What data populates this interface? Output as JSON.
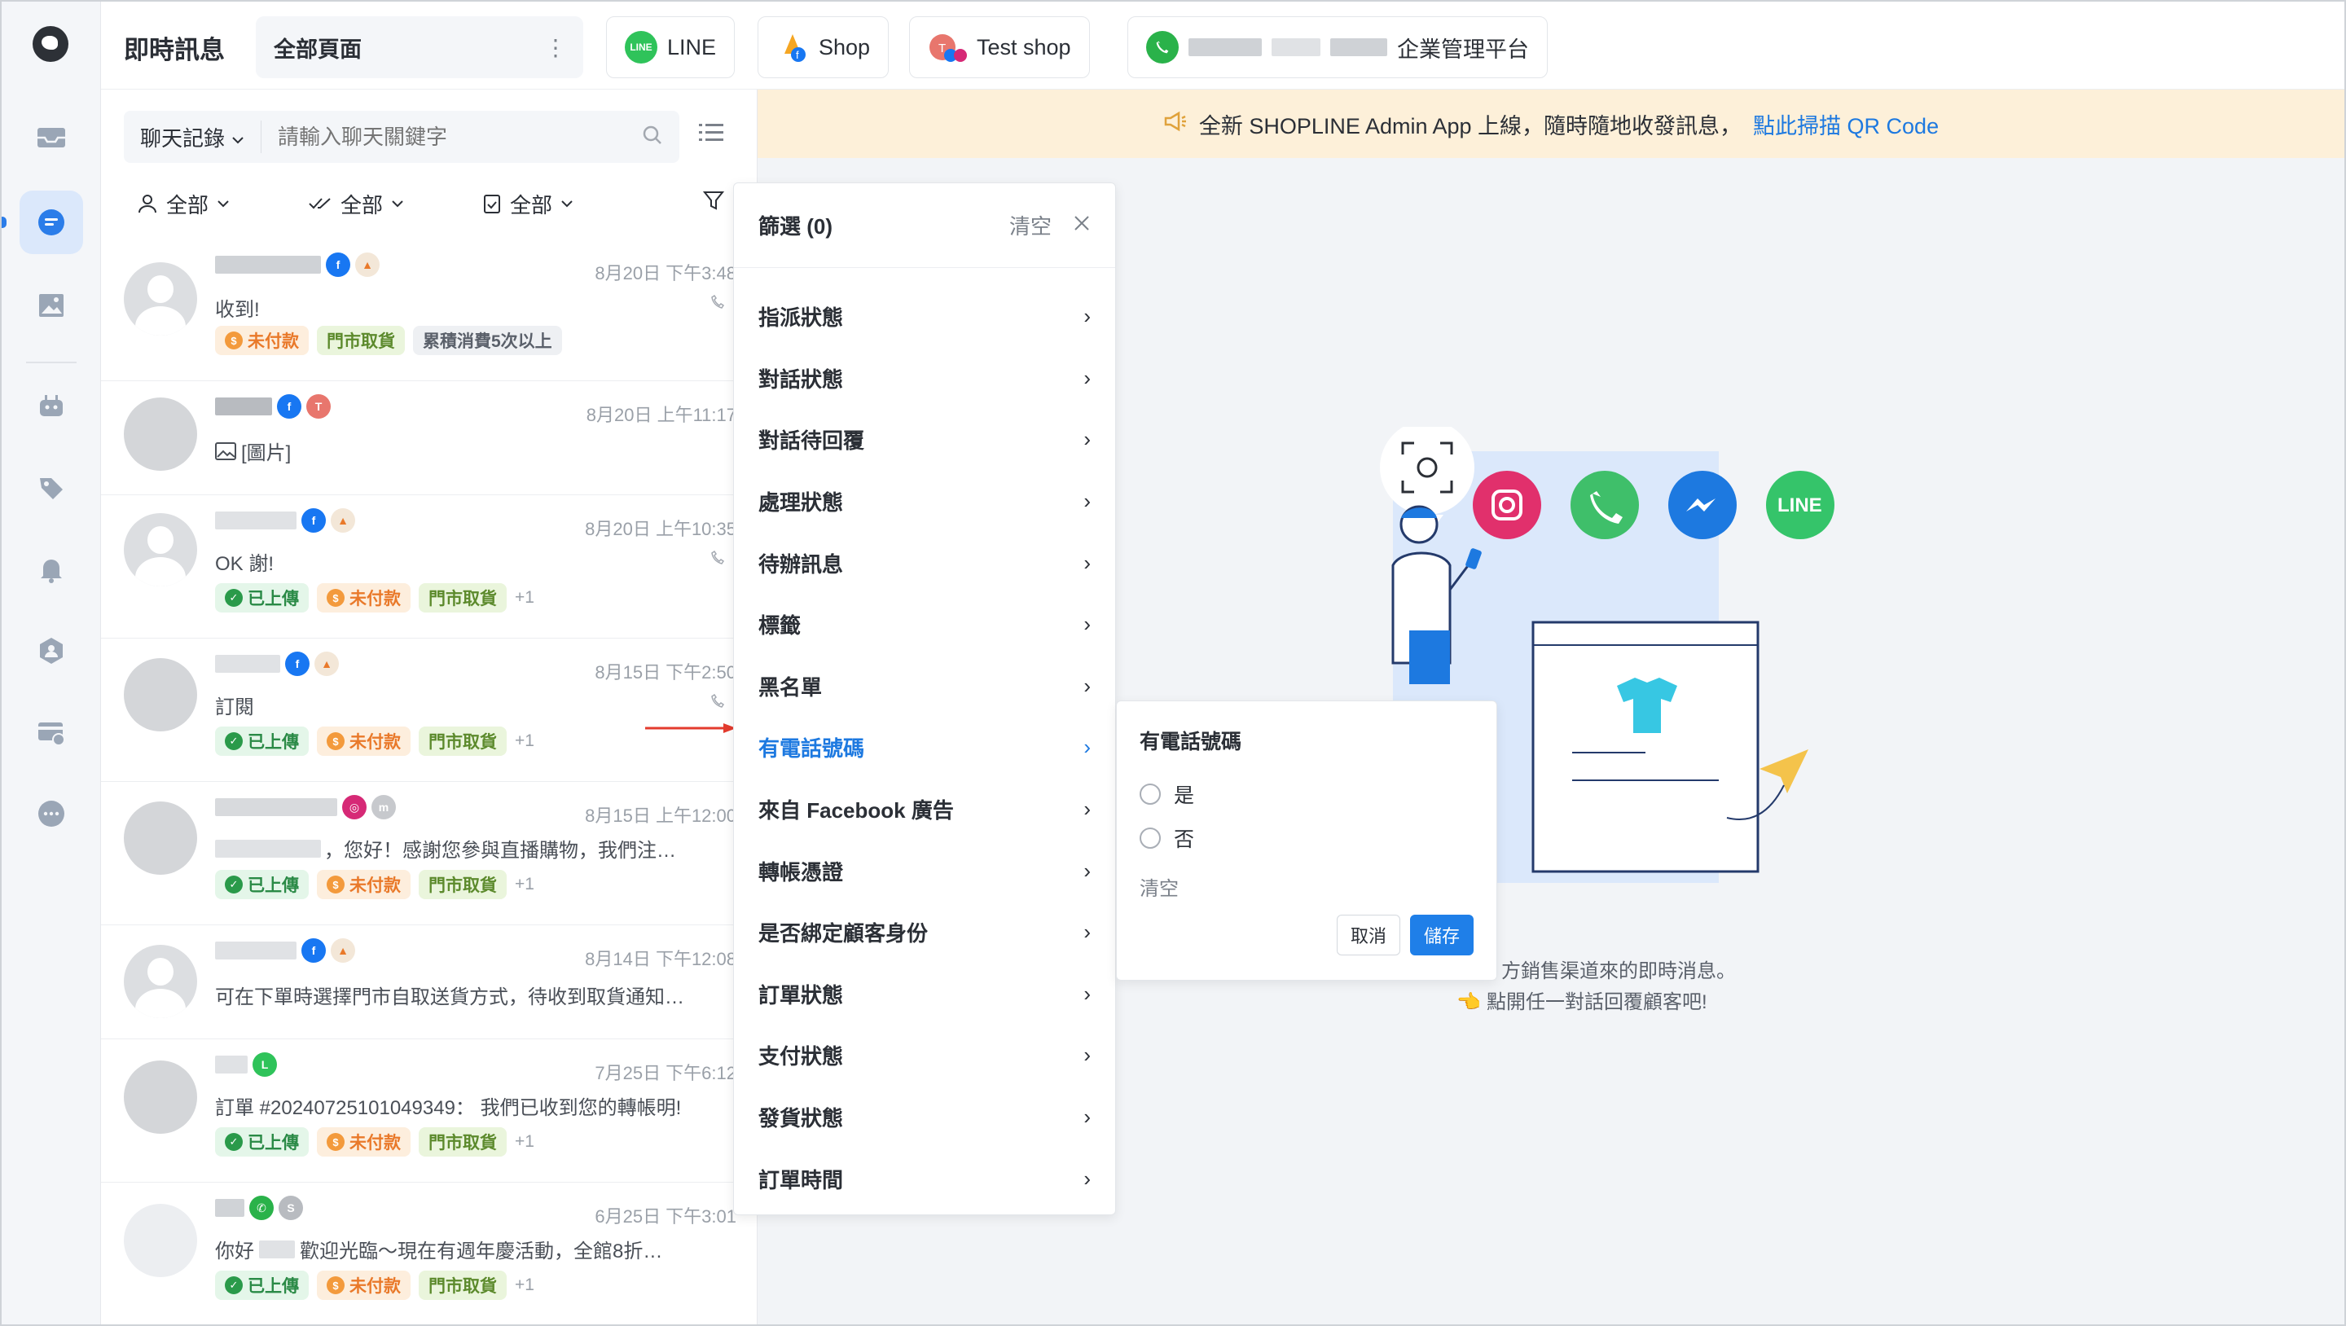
{
  "header": {
    "page_title": "即時訊息",
    "page_select": "全部頁面",
    "channels": [
      {
        "label": "LINE"
      },
      {
        "label": "Shop"
      },
      {
        "label": "Test shop"
      },
      {
        "label": "企業管理平台"
      }
    ]
  },
  "banner": {
    "text": "全新 SHOPLINE Admin App 上線，隨時隨地收發訊息，",
    "link": "點此掃描 QR Code"
  },
  "search": {
    "type": "聊天記錄",
    "placeholder": "請輸入聊天關鍵字"
  },
  "filters": {
    "assignee": "全部",
    "read": "全部",
    "task": "全部"
  },
  "conversations": [
    {
      "time": "8月20日 下午3:48",
      "message": "收到!",
      "tags": [
        "未付款",
        "門市取貨",
        "累積消費5次以上"
      ]
    },
    {
      "time": "8月20日 上午11:17",
      "message": "[圖片]",
      "tags": []
    },
    {
      "time": "8月20日 上午10:35",
      "message": "OK 謝!",
      "tags": [
        "已上傳",
        "未付款",
        "門市取貨"
      ],
      "more": "+1"
    },
    {
      "time": "8月15日 下午2:50",
      "message": "訂閱",
      "tags": [
        "已上傳",
        "未付款",
        "門市取貨"
      ],
      "more": "+1"
    },
    {
      "time": "8月15日 上午12:00",
      "message": "，您好！感謝您參與直播購物，我們注…",
      "tags": [
        "已上傳",
        "未付款",
        "門市取貨"
      ],
      "more": "+1"
    },
    {
      "time": "8月14日 下午12:08",
      "message": "可在下單時選擇門市自取送貨方式，待收到取貨通知…",
      "tags": []
    },
    {
      "time": "7月25日 下午6:12",
      "message": "訂單 #20240725101049349： 我們已收到您的轉帳明!",
      "tags": [
        "已上傳",
        "未付款",
        "門市取貨"
      ],
      "more": "+1"
    },
    {
      "time": "6月25日 下午3:01",
      "message": "歡迎光臨～現在有週年慶活動，全館8折…",
      "prefix": "你好",
      "tags": [
        "已上傳",
        "未付款",
        "門市取貨"
      ],
      "more": "+1"
    }
  ],
  "filter_panel": {
    "title": "篩選 (0)",
    "clear": "清空",
    "items": [
      "指派狀態",
      "對話狀態",
      "對話待回覆",
      "處理狀態",
      "待辦訊息",
      "標籤",
      "黑名單",
      "有電話號碼",
      "來自 Facebook 廣告",
      "轉帳憑證",
      "是否綁定顧客身份",
      "訂單狀態",
      "支付狀態",
      "發貨狀態",
      "訂單時間"
    ],
    "active_index": 7
  },
  "sub_panel": {
    "title": "有電話號碼",
    "options": [
      "是",
      "否"
    ],
    "clear": "清空",
    "cancel": "取消",
    "save": "儲存"
  },
  "empty_state": {
    "line1": "方銷售渠道來的即時消息。",
    "line2": "👈 點開任一對話回覆顧客吧!"
  },
  "colors": {
    "accent": "#1f7fe8",
    "banner_bg": "#fdf0d9",
    "tag_green": "#2a8a46",
    "tag_orange": "#e9792a"
  }
}
